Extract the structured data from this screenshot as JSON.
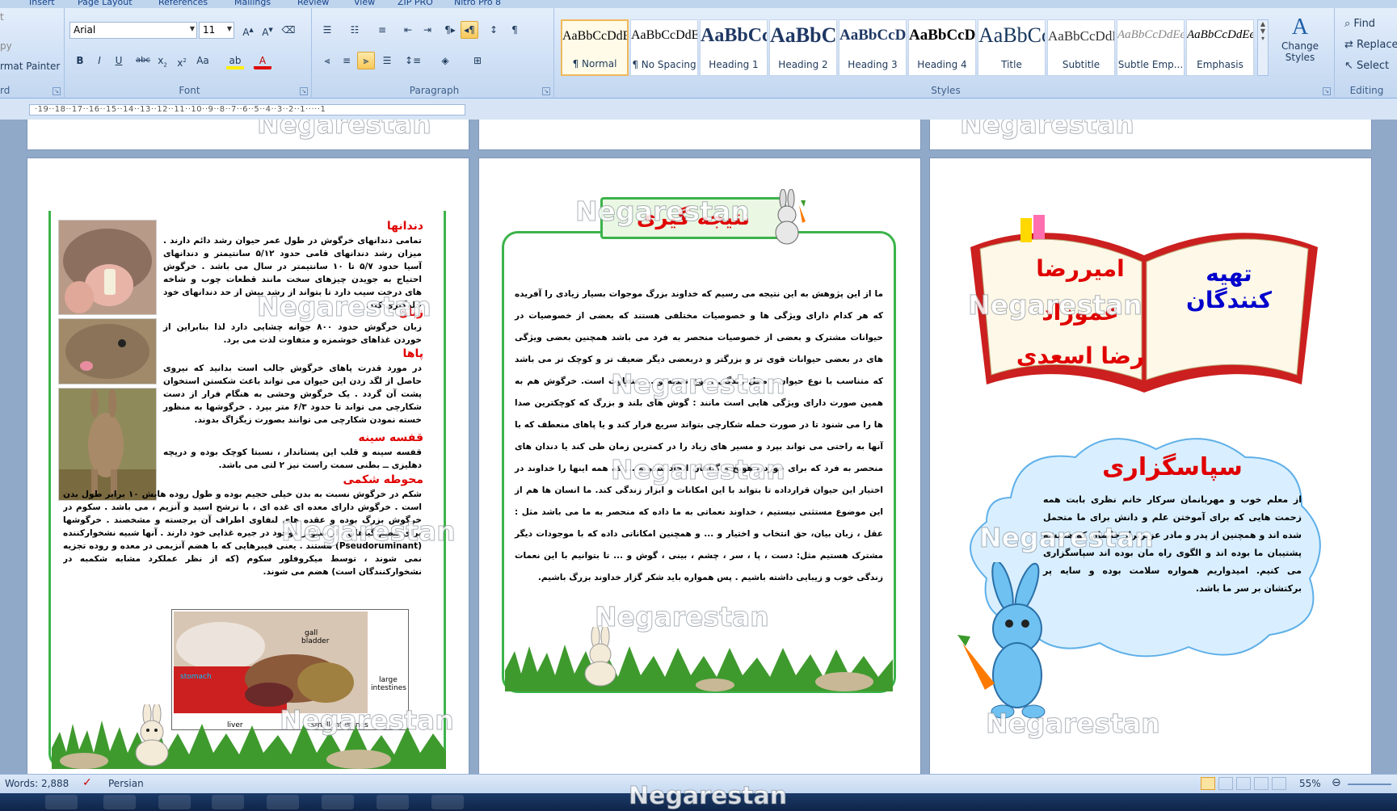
{
  "tabs": [
    "Insert",
    "Page Layout",
    "References",
    "Mailings",
    "Review",
    "View",
    "ZIP PRO",
    "Nitro Pro 8"
  ],
  "clipboard": {
    "items": [
      "py",
      "rmat Painter"
    ],
    "label": "rd"
  },
  "font": {
    "name": "Arial",
    "size": "11",
    "label": "Font"
  },
  "paragraph": {
    "label": "Paragraph"
  },
  "styles": {
    "label": "Styles",
    "items": [
      {
        "sample": "AaBbCcDdEe",
        "label": "¶ Normal"
      },
      {
        "sample": "AaBbCcDdEe",
        "label": "¶ No Spacing"
      },
      {
        "sample": "AaBbCcDdEe",
        "label": "Heading 1"
      },
      {
        "sample": "AaBbCcDdEe",
        "label": "Heading 2"
      },
      {
        "sample": "AaBbCcDdEe",
        "label": "Heading 3"
      },
      {
        "sample": "AaBbCcDdEe",
        "label": "Heading 4"
      },
      {
        "sample": "AaBbCcDdEe",
        "label": "Title"
      },
      {
        "sample": "AaBbCcDdEe",
        "label": "Subtitle"
      },
      {
        "sample": "AaBbCcDdEe",
        "label": "Subtle Emp..."
      },
      {
        "sample": "AaBbCcDdEe",
        "label": "Emphasis"
      }
    ],
    "change_styles": "Change Styles"
  },
  "editing": {
    "find": "Find",
    "replace": "Replace",
    "select": "Select",
    "label": "Editing"
  },
  "ruler": "·19··18··17··16··15··14··13··12··11··10··9··8··7··6··5··4··3··2··1·····1",
  "watermark": "Negarestan",
  "page1": {
    "sections": [
      {
        "title": "دندانها",
        "text": "تمامی دندانهای خرگوش در طول عمر حیوان رشد دائم دارند . میزان رشد دندانهای قامی حدود ۵/۱۲ سانتیمتر و دندانهای آسیا حدود ۵/۷ تا ۱۰ سانتیمتر در سال می باشد . خرگوش احتیاج به جویدن چیزهای سخت مانند قطعات چوب و شاخه های درخت سیب دارد تا بتواند از رشد بیش از حد دندانهای خود جلوگیری کند."
      },
      {
        "title": "زبان",
        "text": "زبان خرگوش حدود ۸۰۰ جوانه چشایی دارد لذا بنابراین از خوردن غذاهای خوشمزه و متفاوت لذت می برد."
      },
      {
        "title": "پاها",
        "text": "در مورد قدرت پاهای خرگوش جالب است بدانید که نیروی حاصل از لگد زدن این حیوان می تواند باعث شکستن استخوان پشت آن گردد . یک خرگوش وحشی به هنگام فرار از دست شکارچی می تواند تا حدود ۶/۳ متر بپرد . خرگوشها به منظور خسته نمودن شکارچی می توانند بصورت زیگزاگ بدوند."
      },
      {
        "title": "قفسه سینه",
        "text": "قفسه سینه و قلب این پستاندار ، نسبتا کوچک بوده و دریچه دهلیزی ــ بطنی سمت راست نیز ۲ لتی می باشد."
      },
      {
        "title": "محوطه شکمی",
        "text": "شکم در خرگوش نسبت به بدن خیلی حجیم بوده و طول روده هایش ۱۰ برابر طول بدن است . خرگوش دارای معده ای غده ای ، با ترشح اسید و آنزیم ، می باشد . سکوم در خرگوش بزرگ بوده و عقده های لنفاوی اطراف آن برجسته و مشخصند . خرگوشها برای هضم گیاهان ، از سلولز موجود در جیره غذایی خود دارند . آنها شبیه نشخوارکننده (Pseudoruminant) هستند . یعنی فیبرهایی که با هضم آنزیمی در معده و روده تجزیه نمی شوند ، توسط میکروفلور سکوم (که از نظر عملکرد مشابه شکمبه در نشخوارکنندگان است) هضم می شوند."
      }
    ],
    "diagram": {
      "gall": "gall",
      "bladder": "bladder",
      "stomach": "stomach",
      "large": "large",
      "intestines": "intestines",
      "liver": "liver",
      "small": "small intestines"
    }
  },
  "page2": {
    "title": "نتیجه گیری",
    "text": "ما از این پژوهش به این نتیجه می رسیم که خداوند بزرگ موجوات بسیار زیادی را آفریده که هر کدام دارای ویژگی ها و خصوصیات مختلفی هستند که بعضی از خصوصیات در حیوانات مشترک و بعضی از خصوصیات منحصر به فرد می باشد همچنین بعضی ویژگی های در بعضی حیوانات قوی تر و بزرگتر و دربعضی دیگر ضعیف تر و کوچک تر می باشد که متناسب با نوع حیوان ، محل زندگی ، نوع تغذیه و ... متفاوت است. خرگوش هم به همین صورت دارای ویژگی هایی است مانند : گوش های بلند و بزرگ که کوچکترین صدا ها را می شنود تا در صورت حمله شکارچی بتواند سریع فرار کند و یا پاهای منعطف که با آنها به راحتی می تواند بپرد و مسیر های زیاد را در کمترین زمان طی کند یا دندان های منحصر به فرد که برای خوردن هویج و گیاهان ایجاد شده و ... که همه اینها را خداوند در اختیار این حیوان قرارداده تا بتواند با این امکانات و ابزار زندگی کند. ما انسان ها هم از این موضوع مستثنی نیستیم ، خداوند نعماتی به ما داده که منحصر به ما می باشد مثل : عقل ، زبان بیان، حق انتخاب و اختیار و ... و همچنین امکاناتی داده که با موجودات دیگر مشترک هستیم مثل: دست ، پا ، سر ، چشم ، بینی ، گوش و ... تا بتوانیم با این نعمات زندگی خوب و زیبایی داشته باشیم . پس همواره باید شکر گزار خداوند بزرگ باشیم."
  },
  "page3": {
    "preparers": "تهیه کنندگان",
    "author1": "امیررضا عموزاد",
    "author2": "رضا اسعدی",
    "thanks_title": "سپاسگزاری",
    "thanks_text": "از معلم خوب و مهربانمان سرکار خانم نظری بابت همه زحمت هایی که برای آموختن علم و دانش برای ما متحمل شده اند و همچنین از پدر و مادر عزیزتراز جانمان که همیشه پشتیبان ما بوده اند و الگوی راه مان بوده اند سپاسگزاری می کنیم. امیدواریم همواره سلامت بوده و سایه پر برکتشان بر سر ما باشد."
  },
  "status": {
    "words": "Words: 2,888",
    "language": "Persian",
    "zoom": "55%"
  },
  "colors": {
    "accent_green": "#3cb34a",
    "title_red": "#e00000",
    "preparers_blue": "#0000cc"
  }
}
